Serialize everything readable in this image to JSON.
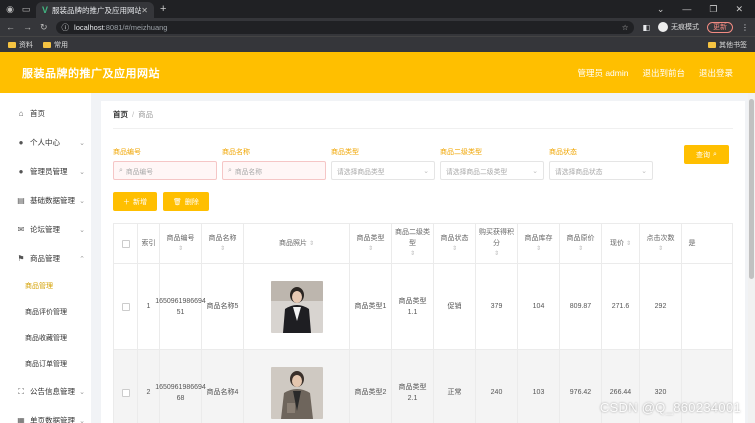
{
  "browser": {
    "tab_title": "服装品牌的推广及应用网站",
    "url_host": "localhost",
    "url_path": ":8081/#/meizhuang",
    "incognito_label": "无痕模式",
    "update_label": "更新",
    "bookmarks": [
      "资料",
      "常用"
    ],
    "bookmarks_right": "其他书签"
  },
  "header": {
    "title": "服装品牌的推广及应用网站",
    "user": "管理员 admin",
    "back_home": "退出到前台",
    "logout": "退出登录"
  },
  "sidebar": {
    "items": [
      {
        "label": "首页",
        "icon": "home-icon",
        "chev": false
      },
      {
        "label": "个人中心",
        "icon": "user-icon",
        "chev": true
      },
      {
        "label": "管理员管理",
        "icon": "admin-icon",
        "chev": true
      },
      {
        "label": "基础数据管理",
        "icon": "data-icon",
        "chev": true
      },
      {
        "label": "论坛管理",
        "icon": "mail-icon",
        "chev": true
      },
      {
        "label": "商品管理",
        "icon": "flag-icon",
        "chev": true,
        "open": true
      }
    ],
    "subitems": [
      "商品管理",
      "商品评价管理",
      "商品收藏管理",
      "商品订单管理"
    ],
    "items_after": [
      {
        "label": "公告信息管理",
        "icon": "notice-icon"
      },
      {
        "label": "单页数据管理",
        "icon": "grid-icon"
      }
    ]
  },
  "breadcrumb": {
    "home": "首页",
    "sep": "/",
    "current": "商品"
  },
  "filters": [
    {
      "label": "商品编号",
      "placeholder": "商品编号",
      "type": "input"
    },
    {
      "label": "商品名称",
      "placeholder": "商品名称",
      "type": "input"
    },
    {
      "label": "商品类型",
      "placeholder": "请选择商品类型",
      "type": "select"
    },
    {
      "label": "商品二级类型",
      "placeholder": "请选择商品二级类型",
      "type": "select"
    },
    {
      "label": "商品状态",
      "placeholder": "请选择商品状态",
      "type": "select"
    }
  ],
  "search_label": "查询",
  "actions": {
    "add": "新增",
    "delete": "删除"
  },
  "table": {
    "headers": [
      "索引",
      "商品编号",
      "商品名称",
      "商品照片",
      "商品类型",
      "商品二级类型",
      "商品状态",
      "购买获得积分",
      "商品库存",
      "商品原价",
      "现价",
      "点击次数",
      "是"
    ],
    "rows": [
      {
        "index": "1",
        "code": "1650961986694 51",
        "name": "商品名称5",
        "type": "商品类型1",
        "subtype": "商品类型1.1",
        "status": "促销",
        "points": "379",
        "stock": "104",
        "orig": "809.87",
        "price": "271.6",
        "clicks": "292"
      },
      {
        "index": "2",
        "code": "1650961986694 68",
        "name": "商品名称4",
        "type": "商品类型2",
        "subtype": "商品类型2.1",
        "status": "正常",
        "points": "240",
        "stock": "103",
        "orig": "976.42",
        "price": "266.44",
        "clicks": "320"
      }
    ]
  },
  "watermark": "CSDN @Q_860234001",
  "colors": {
    "accent": "#ffbf00",
    "label": "#f0a500"
  }
}
